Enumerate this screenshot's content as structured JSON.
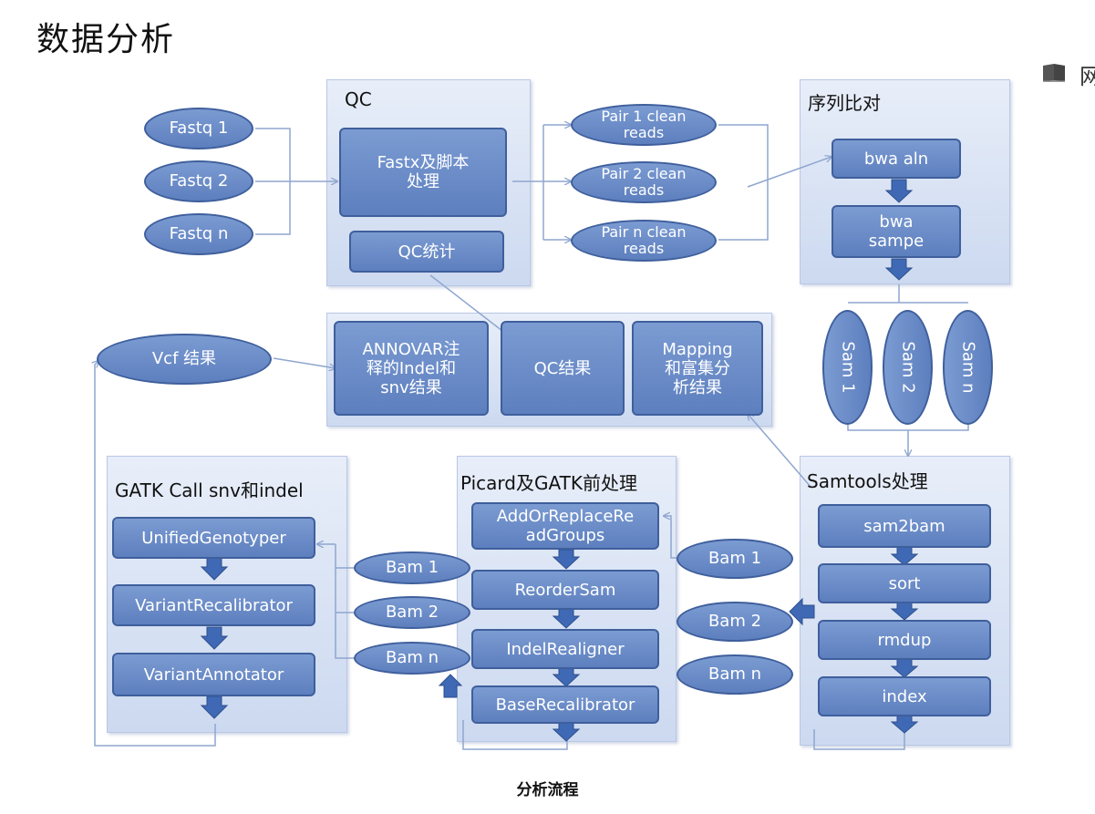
{
  "page_title": "数据分析",
  "caption": "分析流程",
  "corner_glyph": "网",
  "colors": {
    "node_fill": "#6a8cc8",
    "node_border": "#3f5f9c",
    "panel_fill": "#d6e1f3",
    "line": "#8fa6cf"
  },
  "inputs": {
    "fastq1": "Fastq 1",
    "fastq2": "Fastq 2",
    "fastqn": "Fastq n"
  },
  "qc": {
    "title": "QC",
    "fastx": "Fastx及脚本\n处理",
    "stats": "QC统计"
  },
  "clean_reads": {
    "pair1": "Pair 1 clean\nreads",
    "pair2": "Pair 2 clean\nreads",
    "pairn": "Pair n clean\nreads"
  },
  "alignment": {
    "title": "序列比对",
    "bwa_aln": "bwa aln",
    "bwa_sampe": "bwa\nsampe"
  },
  "sam": {
    "sam1": "Sam 1",
    "sam2": "Sam 2",
    "samn": "Sam n"
  },
  "results": {
    "annovar": "ANNOVAR注\n释的Indel和\nsnv结果",
    "qc_result": "QC结果",
    "mapping": "Mapping\n和富集分\n析结果"
  },
  "vcf": "Vcf 结果",
  "gatk": {
    "title": "GATK Call snv和indel",
    "ug": "UnifiedGenotyper",
    "vr": "VariantRecalibrator",
    "va": "VariantAnnotator"
  },
  "bam_left": {
    "bam1": "Bam 1",
    "bam2": "Bam 2",
    "bamn": "Bam n"
  },
  "picard": {
    "title": "Picard及GATK前处理",
    "add": "AddOrReplaceRe\nadGroups",
    "reorder": "ReorderSam",
    "indel": "IndelRealigner",
    "base": "BaseRecalibrator"
  },
  "bam_right": {
    "bam1": "Bam 1",
    "bam2": "Bam 2",
    "bamn": "Bam n"
  },
  "samtools": {
    "title": "Samtools处理",
    "sam2bam": "sam2bam",
    "sort": "sort",
    "rmdup": "rmdup",
    "index": "index"
  }
}
